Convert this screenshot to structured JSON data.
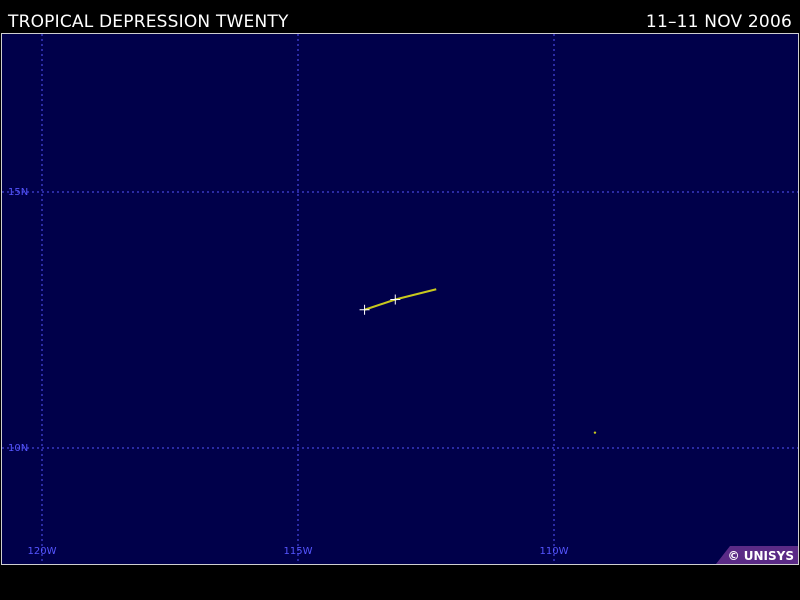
{
  "header": {
    "storm_name": "TROPICAL DEPRESSION TWENTY",
    "date_range": "11–11 NOV 2006"
  },
  "map": {
    "background_color": "#00004a",
    "grid_color": "#5555ff",
    "track_color": "#c8c81e",
    "lat_labels": [
      {
        "lat": 15,
        "label": "15N"
      },
      {
        "lat": 10,
        "label": "10N"
      }
    ],
    "lon_labels": [
      {
        "lon": -120,
        "label": "120W"
      },
      {
        "lon": -115,
        "label": "115W"
      },
      {
        "lon": -110,
        "label": "110W"
      }
    ],
    "track_points": [
      {
        "lat": 12.7,
        "lon": -113.7
      },
      {
        "lat": 12.9,
        "lon": -113.1
      },
      {
        "lat": 13.1,
        "lon": -112.3
      }
    ],
    "track_markers": [
      {
        "lat": 12.7,
        "lon": -113.7
      },
      {
        "lat": 12.9,
        "lon": -113.1
      }
    ],
    "stray_point": {
      "lat": 10.3,
      "lon": -109.2
    }
  },
  "copyright": {
    "text": "© UNISYS"
  }
}
